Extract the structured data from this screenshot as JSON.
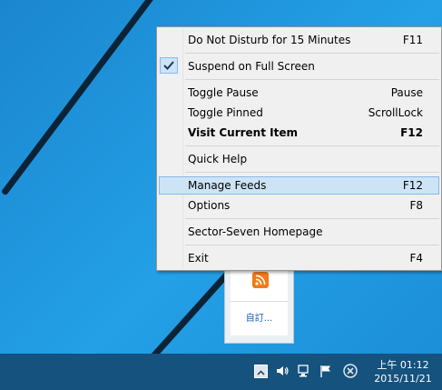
{
  "menu": {
    "items": [
      {
        "label": "Do Not Disturb for 15 Minutes",
        "shortcut": "F11"
      },
      {
        "label": "Suspend on Full Screen",
        "shortcut": "",
        "checked": true
      },
      {
        "label": "Toggle Pause",
        "shortcut": "Pause"
      },
      {
        "label": "Toggle Pinned",
        "shortcut": "ScrollLock"
      },
      {
        "label": "Visit Current Item",
        "shortcut": "F12",
        "bold": true
      },
      {
        "label": "Quick Help",
        "shortcut": ""
      },
      {
        "label": "Manage Feeds",
        "shortcut": "F12",
        "highlighted": true
      },
      {
        "label": "Options",
        "shortcut": "F8"
      },
      {
        "label": "Sector-Seven Homepage",
        "shortcut": ""
      },
      {
        "label": "Exit",
        "shortcut": "F4"
      }
    ]
  },
  "tray_overflow": {
    "app_icon": "rss-feed-icon",
    "customize_label": "自訂..."
  },
  "taskbar": {
    "icons": [
      "show-hidden-icons-icon",
      "volume-icon",
      "network-icon",
      "action-center-flag-icon",
      "close-circle-icon"
    ],
    "clock": {
      "time": "上午 01:12",
      "date": "2015/11/21"
    }
  },
  "colors": {
    "desktop": "#1e8fd6",
    "taskbar": "#15527e",
    "menu_bg": "#f0f0f0",
    "highlight": "#cde4f7",
    "highlight_border": "#8bb8e6",
    "rss": "#f07a18"
  }
}
